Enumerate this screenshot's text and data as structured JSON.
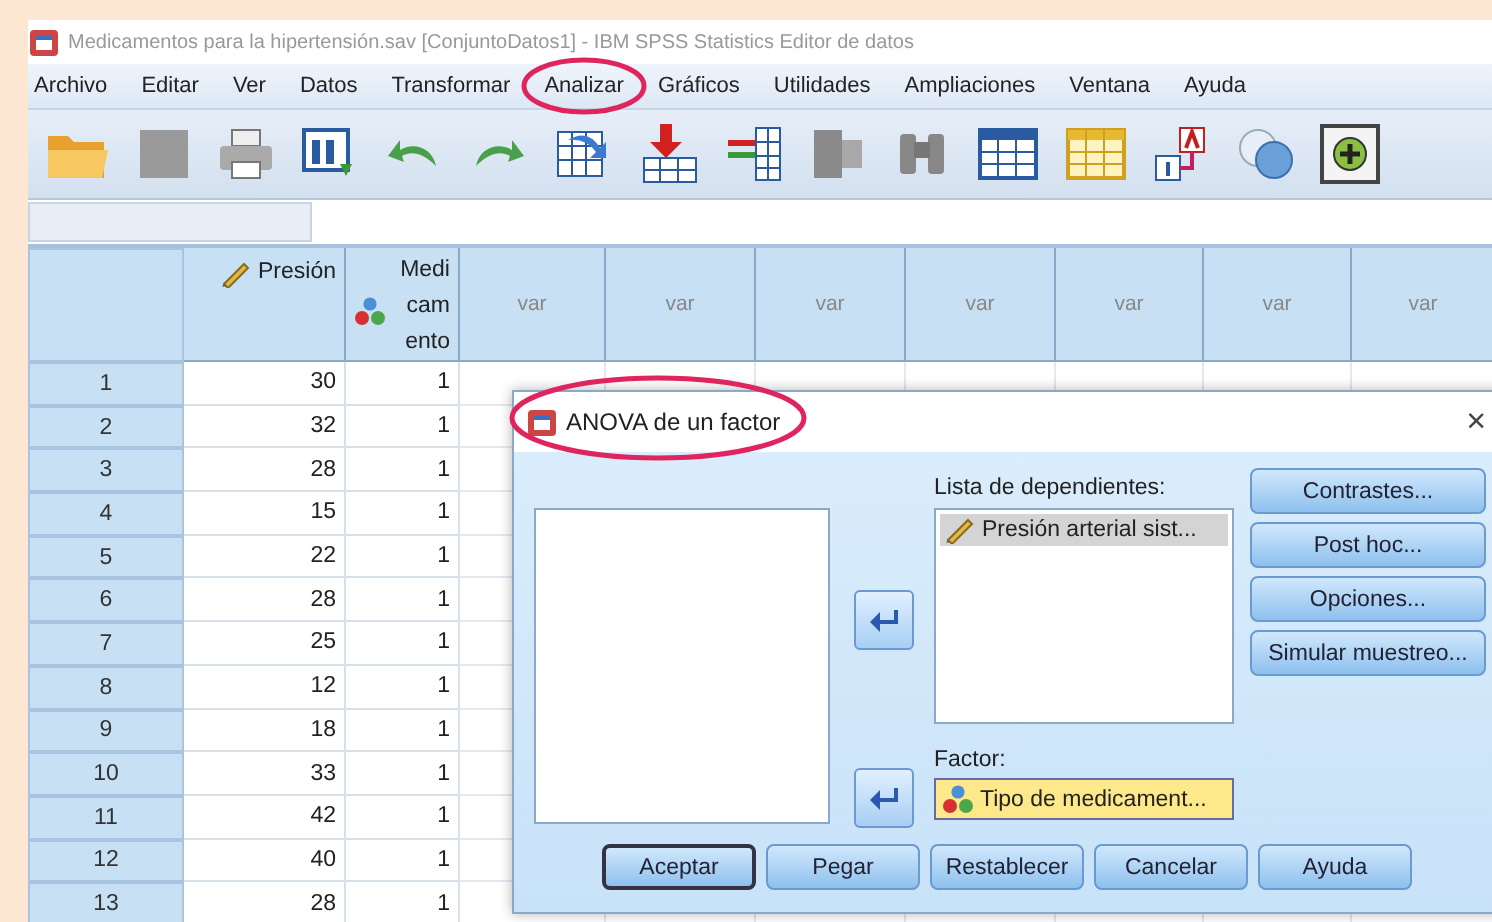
{
  "window": {
    "title": "Medicamentos para la hipertensión.sav [ConjuntoDatos1] - IBM SPSS Statistics Editor de datos"
  },
  "menu": [
    {
      "label": "Archivo",
      "highlighted": false
    },
    {
      "label": "Editar",
      "highlighted": false
    },
    {
      "label": "Ver",
      "highlighted": false
    },
    {
      "label": "Datos",
      "highlighted": false
    },
    {
      "label": "Transformar",
      "highlighted": false
    },
    {
      "label": "Analizar",
      "highlighted": true
    },
    {
      "label": "Gráficos",
      "highlighted": false
    },
    {
      "label": "Utilidades",
      "highlighted": false
    },
    {
      "label": "Ampliaciones",
      "highlighted": false
    },
    {
      "label": "Ventana",
      "highlighted": false
    },
    {
      "label": "Ayuda",
      "highlighted": false
    }
  ],
  "grid": {
    "columns": [
      {
        "label": "Presión",
        "kind": "scale"
      },
      {
        "label": "Medi cam ento",
        "kind": "nominal"
      },
      {
        "label": "var",
        "kind": "empty"
      },
      {
        "label": "var",
        "kind": "empty"
      },
      {
        "label": "var",
        "kind": "empty"
      },
      {
        "label": "var",
        "kind": "empty"
      },
      {
        "label": "var",
        "kind": "empty"
      },
      {
        "label": "var",
        "kind": "empty"
      },
      {
        "label": "var",
        "kind": "empty"
      }
    ],
    "rows": [
      {
        "case": "1",
        "values": [
          "30",
          "1"
        ]
      },
      {
        "case": "2",
        "values": [
          "32",
          "1"
        ]
      },
      {
        "case": "3",
        "values": [
          "28",
          "1"
        ]
      },
      {
        "case": "4",
        "values": [
          "15",
          "1"
        ]
      },
      {
        "case": "5",
        "values": [
          "22",
          "1"
        ]
      },
      {
        "case": "6",
        "values": [
          "28",
          "1"
        ]
      },
      {
        "case": "7",
        "values": [
          "25",
          "1"
        ]
      },
      {
        "case": "8",
        "values": [
          "12",
          "1"
        ]
      },
      {
        "case": "9",
        "values": [
          "18",
          "1"
        ]
      },
      {
        "case": "10",
        "values": [
          "33",
          "1"
        ]
      },
      {
        "case": "11",
        "values": [
          "42",
          "1"
        ]
      },
      {
        "case": "12",
        "values": [
          "40",
          "1"
        ]
      },
      {
        "case": "13",
        "values": [
          "28",
          "1"
        ]
      }
    ]
  },
  "dialog": {
    "title": "ANOVA de un factor",
    "highlighted": true,
    "close": "×",
    "dependents_label": "Lista de dependientes:",
    "dependents": [
      {
        "label": "Presión arterial sist...",
        "kind": "scale",
        "selected": true
      }
    ],
    "factor_label": "Factor:",
    "factor": {
      "label": "Tipo de medicament...",
      "kind": "nominal"
    },
    "side_buttons": [
      "Contrastes...",
      "Post hoc...",
      "Opciones...",
      "Simular muestreo..."
    ],
    "buttons": [
      {
        "label": "Aceptar",
        "default": true
      },
      {
        "label": "Pegar",
        "default": false
      },
      {
        "label": "Restablecer",
        "default": false
      },
      {
        "label": "Cancelar",
        "default": false
      },
      {
        "label": "Ayuda",
        "default": false
      }
    ]
  }
}
